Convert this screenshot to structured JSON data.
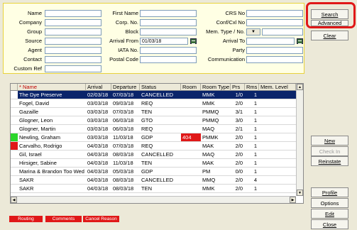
{
  "form": {
    "name": {
      "label": "Name",
      "value": ""
    },
    "company": {
      "label": "Company",
      "value": ""
    },
    "group": {
      "label": "Group",
      "value": ""
    },
    "source": {
      "label": "Source",
      "value": ""
    },
    "agent": {
      "label": "Agent",
      "value": ""
    },
    "contact": {
      "label": "Contact",
      "value": ""
    },
    "custom_ref": {
      "label": "Custom Ref",
      "value": ""
    },
    "first_name": {
      "label": "First Name",
      "value": ""
    },
    "corp_no": {
      "label": "Corp. No.",
      "value": ""
    },
    "block": {
      "label": "Block",
      "value": ""
    },
    "arrival_from": {
      "label": "Arrival From",
      "value": "01/03/18"
    },
    "iata_no": {
      "label": "IATA No.",
      "value": ""
    },
    "postal_code": {
      "label": "Postal Code",
      "value": ""
    },
    "crs_no": {
      "label": "CRS No",
      "value": ""
    },
    "conf_cxl_no": {
      "label": "Conf/Cxl No",
      "value": ""
    },
    "mem_type_no": {
      "label": "Mem. Type / No.",
      "value": ""
    },
    "arrival_to": {
      "label": "Arrival To",
      "value": ""
    },
    "party": {
      "label": "Party",
      "value": ""
    },
    "communication": {
      "label": "Communication",
      "value": ""
    }
  },
  "buttons": {
    "search": "Search",
    "advanced": "Advanced",
    "clear": "Clear",
    "new": "New",
    "check_in": "Check In",
    "reinstate": "Reinstate",
    "profile": "Profile",
    "options": "Options",
    "edit": "Edit",
    "close": "Close"
  },
  "grid": {
    "columns": [
      "* Name",
      "Arrival",
      "Departure",
      "Status",
      "Room",
      "Room Type",
      "Prs",
      "Rms",
      "Mem. Level"
    ],
    "rows": [
      {
        "marker": "",
        "room_color": "",
        "cells": [
          "The Dye Preserve",
          "02/03/18",
          "07/03/18",
          "CANCELLED",
          "",
          "MMK",
          "1/0",
          "1",
          ""
        ]
      },
      {
        "marker": "",
        "room_color": "",
        "cells": [
          "Fogel, David",
          "03/03/18",
          "09/03/18",
          "REQ",
          "",
          "MMK",
          "2/0",
          "1",
          ""
        ]
      },
      {
        "marker": "",
        "room_color": "",
        "cells": [
          "Gazaille",
          "03/03/18",
          "07/03/18",
          "TEN",
          "",
          "PMMQ",
          "3/1",
          "1",
          ""
        ]
      },
      {
        "marker": "",
        "room_color": "",
        "cells": [
          "Glogner, Leon",
          "03/03/18",
          "06/03/18",
          "GTO",
          "",
          "PMMQ",
          "3/0",
          "1",
          ""
        ]
      },
      {
        "marker": "",
        "room_color": "",
        "cells": [
          "Glogner, Martin",
          "03/03/18",
          "06/03/18",
          "REQ",
          "",
          "MAQ",
          "2/1",
          "1",
          ""
        ]
      },
      {
        "marker": "#2BD62B",
        "room_color": "#E01818",
        "cells": [
          "Newling, Graham",
          "03/03/18",
          "11/03/18",
          "GDP",
          "404",
          "PMMK",
          "2/0",
          "1",
          ""
        ]
      },
      {
        "marker": "#E01818",
        "room_color": "",
        "cells": [
          "Carvalho, Rodrigo",
          "04/03/18",
          "07/03/18",
          "REQ",
          "",
          "MAK",
          "2/0",
          "1",
          ""
        ]
      },
      {
        "marker": "",
        "room_color": "",
        "cells": [
          "Gil, Israel",
          "04/03/18",
          "08/03/18",
          "CANCELLED",
          "",
          "MAQ",
          "2/0",
          "1",
          ""
        ]
      },
      {
        "marker": "",
        "room_color": "",
        "cells": [
          "Hirsiger, Sabine",
          "04/03/18",
          "11/03/18",
          "TEN",
          "",
          "MAK",
          "2/0",
          "1",
          ""
        ]
      },
      {
        "marker": "",
        "room_color": "",
        "cells": [
          "Marina & Brandon Too Wed",
          "04/03/18",
          "05/03/18",
          "GDP",
          "",
          "PM",
          "0/0",
          "1",
          ""
        ]
      },
      {
        "marker": "",
        "room_color": "",
        "cells": [
          "SAKR",
          "04/03/18",
          "08/03/18",
          "CANCELLED",
          "",
          "MMQ",
          "2/0",
          "4",
          ""
        ]
      },
      {
        "marker": "",
        "room_color": "",
        "cells": [
          "SAKR",
          "04/03/18",
          "08/03/18",
          "TEN",
          "",
          "MMK",
          "2/0",
          "1",
          ""
        ]
      }
    ]
  },
  "tags": {
    "routing": "Routing",
    "comments": "Comments",
    "cancel_reason": "Cancel Reason"
  },
  "colors": {
    "selected_row": "#0A246A",
    "search_highlight": "#E01818",
    "panel_border": "#E8D23C"
  },
  "icons": {
    "calendar": "calendar-icon",
    "dropdown": "chevron-down-icon"
  }
}
